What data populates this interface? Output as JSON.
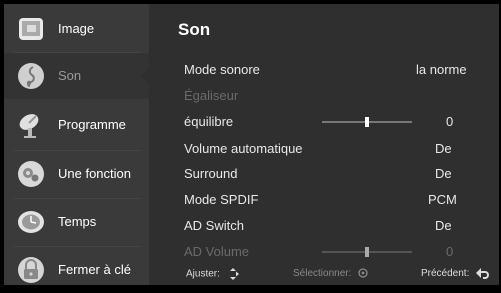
{
  "sidebar": {
    "items": [
      {
        "label": "Image",
        "icon": "image-icon"
      },
      {
        "label": "Son",
        "icon": "music-note-icon"
      },
      {
        "label": "Programme",
        "icon": "satellite-dish-icon"
      },
      {
        "label": "Une fonction",
        "icon": "function-gears-icon"
      },
      {
        "label": "Temps",
        "icon": "clock-icon"
      },
      {
        "label": "Fermer à clé",
        "icon": "lock-icon"
      }
    ],
    "active_index": 1
  },
  "main": {
    "title": "Son",
    "rows": [
      {
        "label": "Mode sonore",
        "value": "la norme",
        "enabled": true
      },
      {
        "label": "Égaliseur",
        "value": "",
        "enabled": false
      },
      {
        "label": "équilibre",
        "value": "0",
        "enabled": true,
        "slider": true
      },
      {
        "label": "Volume automatique",
        "value": "De",
        "enabled": true
      },
      {
        "label": "Surround",
        "value": "De",
        "enabled": true
      },
      {
        "label": "Mode SPDIF",
        "value": "PCM",
        "enabled": true
      },
      {
        "label": "AD Switch",
        "value": "De",
        "enabled": true
      },
      {
        "label": "AD Volume",
        "value": "0",
        "enabled": false,
        "slider": true
      }
    ]
  },
  "footer": {
    "adjust": "Ajuster:",
    "select": "Sélectionner:",
    "back": "Précédent:"
  },
  "colors": {
    "background": "#2f2f2f",
    "sidebar": "#3a3a3a",
    "disabled_text": "#6a6a6a"
  }
}
